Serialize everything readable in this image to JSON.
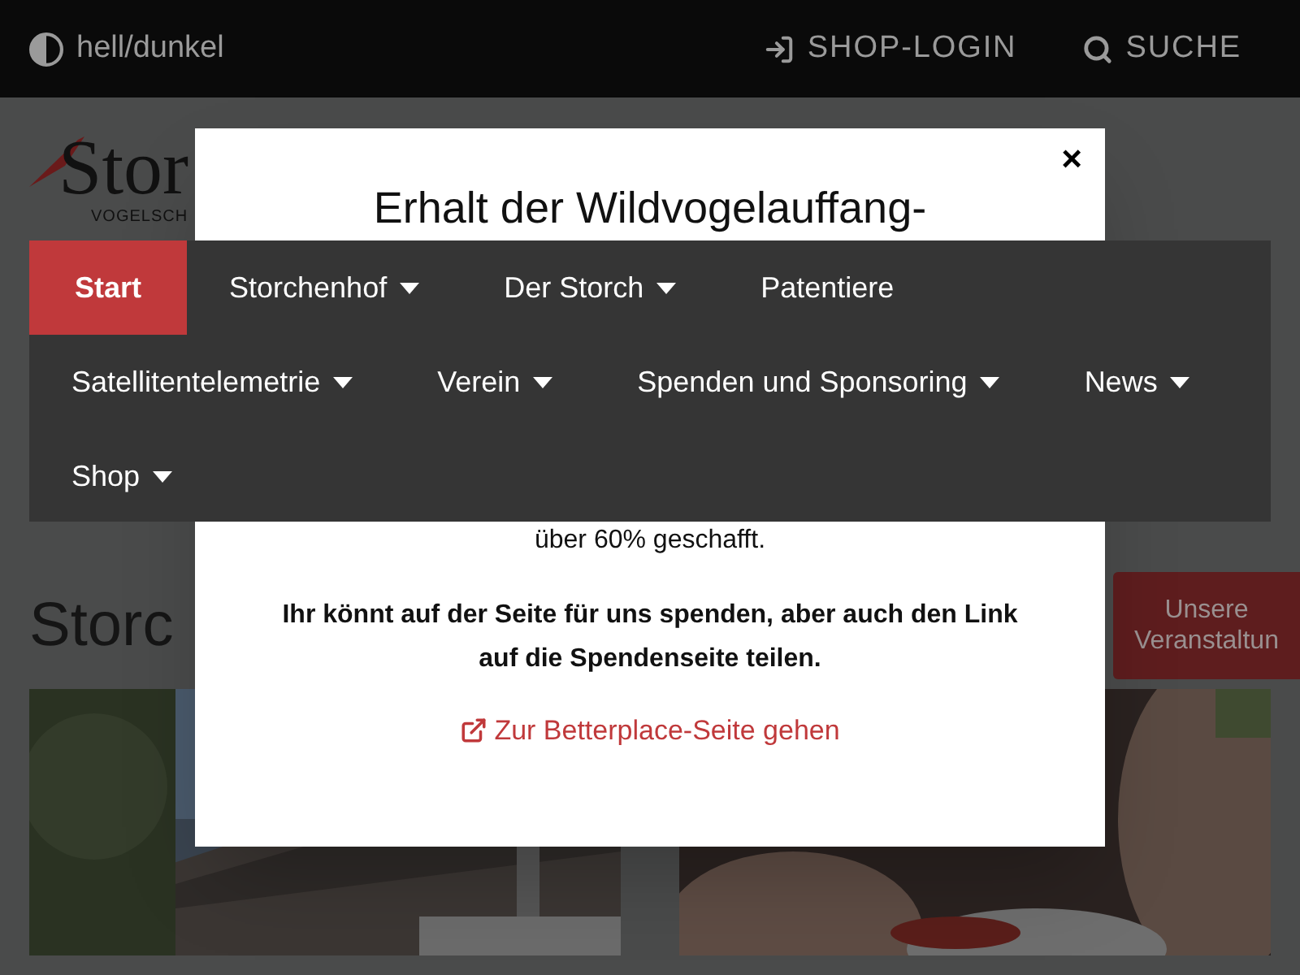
{
  "top_bar": {
    "theme_toggle": "hell/dunkel",
    "shop_login": "SHOP-LOGIN",
    "search": "SUCHE"
  },
  "logo": {
    "name": "Stor",
    "subtitle": "VOGELSCH"
  },
  "page": {
    "heading": "Storc",
    "events_button": "Unsere Veranstaltun"
  },
  "modal": {
    "close": "×",
    "title": "Erhalt der Wildvogelauffang-",
    "progress_text": "über 60% geschafft.",
    "appeal": "Ihr könnt auf der Seite für uns spenden, aber auch den Link auf die Spendenseite teilen.",
    "link": "Zur Betterplace-Seite gehen"
  },
  "menu": [
    {
      "label": "Start",
      "selected": true,
      "dropdown": false
    },
    {
      "label": "Storchenhof",
      "selected": false,
      "dropdown": true
    },
    {
      "label": "Der Storch",
      "selected": false,
      "dropdown": true
    },
    {
      "label": "Patentiere",
      "selected": false,
      "dropdown": false
    },
    {
      "label": "Satellitentelemetrie",
      "selected": false,
      "dropdown": true
    },
    {
      "label": "Verein",
      "selected": false,
      "dropdown": true
    },
    {
      "label": "Spenden und Sponsoring",
      "selected": false,
      "dropdown": true
    },
    {
      "label": "News",
      "selected": false,
      "dropdown": true
    },
    {
      "label": "Shop",
      "selected": false,
      "dropdown": true
    }
  ]
}
